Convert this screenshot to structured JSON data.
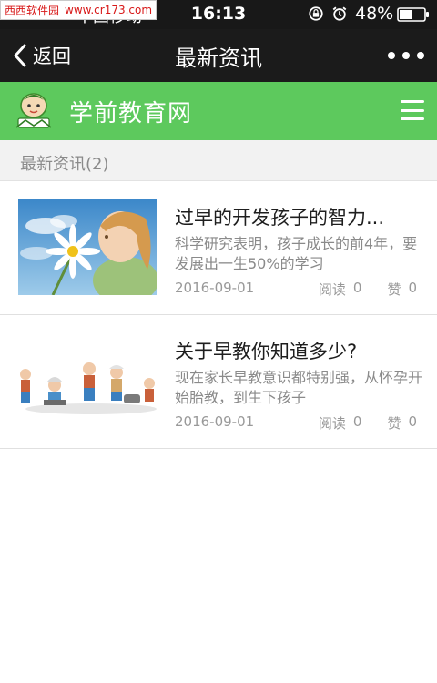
{
  "watermark": {
    "brand": "西西软件园",
    "url": "www.cr173.com"
  },
  "status_bar": {
    "carrier": "中国移动",
    "time": "16:13",
    "battery": "48%"
  },
  "nav": {
    "back_label": "返回",
    "title": "最新资讯"
  },
  "header": {
    "site_name": "学前教育网",
    "logo_text": "学前教育网"
  },
  "section": {
    "label": "最新资讯(2)"
  },
  "articles": [
    {
      "title": "过早的开发孩子的智力...",
      "summary": "科学研究表明，孩子成长的前4年，要发展出一生50%的学习",
      "date": "2016-09-01",
      "read_label": "阅读",
      "read_count": "0",
      "like_label": "赞",
      "like_count": "0"
    },
    {
      "title": "关于早教你知道多少?",
      "summary": "现在家长早教意识都特别强，从怀孕开始胎教，到生下孩子",
      "date": "2016-09-01",
      "read_label": "阅读",
      "read_count": "0",
      "like_label": "赞",
      "like_count": "0"
    }
  ],
  "colors": {
    "accent_green": "#5dc95d",
    "dark_bar": "#1b1b1b"
  }
}
